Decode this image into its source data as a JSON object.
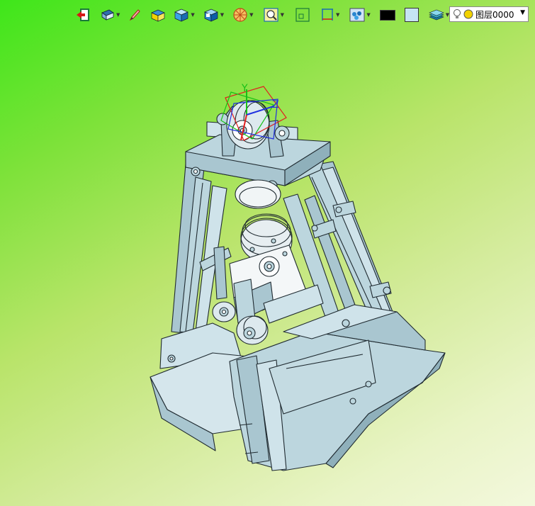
{
  "toolbar": {
    "items": [
      {
        "id": "exit",
        "icon": "exit-icon"
      },
      {
        "id": "view-mode",
        "icon": "view-mode-icon",
        "has_dropdown": true
      },
      {
        "id": "pencil",
        "icon": "pencil-icon"
      },
      {
        "id": "box-yellow",
        "icon": "yellow-box-icon"
      },
      {
        "id": "box-shaded",
        "icon": "shaded-cube-icon",
        "has_dropdown": true
      },
      {
        "id": "view-cube",
        "icon": "view-cube-icon",
        "has_dropdown": true
      },
      {
        "id": "section",
        "icon": "section-icon",
        "has_dropdown": true
      },
      {
        "id": "zoom",
        "icon": "zoom-window-icon",
        "has_dropdown": true
      },
      {
        "id": "fit",
        "icon": "fit-icon"
      },
      {
        "id": "measure",
        "icon": "measure-icon",
        "has_dropdown": true
      },
      {
        "id": "render",
        "icon": "render-icon",
        "has_dropdown": true
      },
      {
        "id": "fg-color",
        "icon": "foreground-color-swatch",
        "color": "#000000"
      },
      {
        "id": "bg-color",
        "icon": "background-color-swatch",
        "color": "#c6e4f2"
      },
      {
        "id": "layers",
        "icon": "layers-icon",
        "has_dropdown": true
      }
    ]
  },
  "layer_selector": {
    "value": "图层0000"
  },
  "axes": {
    "y_label": "Y",
    "z_label": "Z"
  },
  "colors": {
    "model_fill": "#bcd6de",
    "model_dark": "#8fb0bb",
    "model_stroke": "#1f2a30",
    "axis_x": "#e02020",
    "axis_y": "#18c018",
    "axis_z": "#2030e0"
  }
}
